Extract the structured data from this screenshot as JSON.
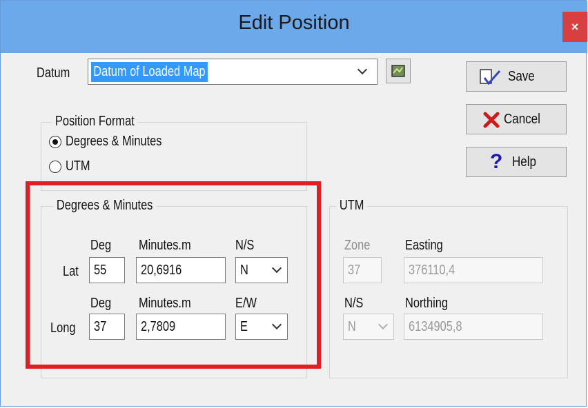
{
  "window": {
    "title": "Edit Position",
    "close_label": "×"
  },
  "datum": {
    "label": "Datum",
    "value": "Datum of Loaded Map"
  },
  "buttons": {
    "save": "Save",
    "cancel": "Cancel",
    "help": "Help"
  },
  "position_format": {
    "title": "Position Format",
    "options": [
      "Degrees & Minutes",
      "UTM"
    ],
    "selected": "Degrees & Minutes"
  },
  "deg_min": {
    "title": "Degrees & Minutes",
    "lat": {
      "label": "Lat",
      "deg_header": "Deg",
      "min_header": "Minutes.m",
      "dir_header": "N/S",
      "deg": "55",
      "min": "20,6916",
      "dir": "N"
    },
    "long": {
      "label": "Long",
      "deg_header": "Deg",
      "min_header": "Minutes.m",
      "dir_header": "E/W",
      "deg": "37",
      "min": "2,7809",
      "dir": "E"
    }
  },
  "utm": {
    "title": "UTM",
    "zone_header": "Zone",
    "zone": "37",
    "easting_header": "Easting",
    "easting": "376110,4",
    "ns_header": "N/S",
    "ns": "N",
    "northing_header": "Northing",
    "northing": "6134905,8"
  },
  "colors": {
    "titlebar": "#6ca9ea",
    "highlight": "#e01e24",
    "selection": "#3399ff"
  }
}
